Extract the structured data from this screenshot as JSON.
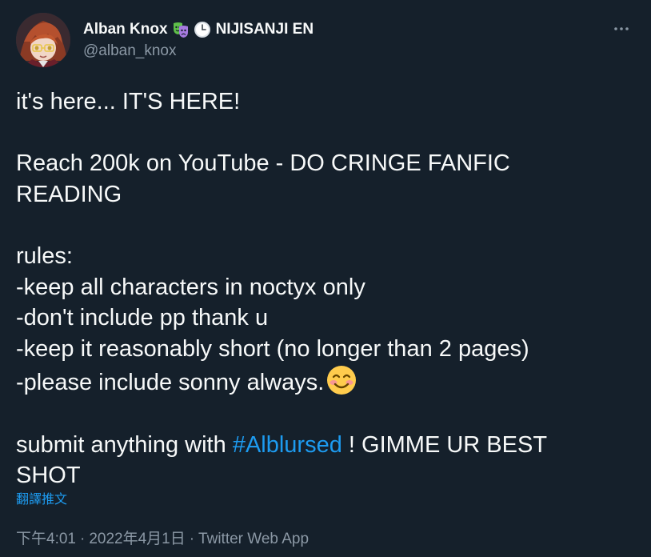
{
  "author": {
    "display_name": "Alban Knox",
    "badge_icons": [
      "theater-masks-icon",
      "clock-icon"
    ],
    "name_suffix": "NIJISANJI EN",
    "handle": "@alban_knox"
  },
  "tweet": {
    "lines": [
      "it's here... IT'S HERE!",
      "",
      "Reach 200k on YouTube - DO CRINGE FANFIC",
      "READING",
      "",
      "rules:",
      "-keep all characters in noctyx only",
      "-don't include pp thank u",
      "-keep it reasonably short (no longer than 2 pages)",
      "-please include sonny always.",
      ""
    ],
    "closing_prefix": "submit anything with ",
    "hashtag": "#Alblursed",
    "closing_suffix": " ! GIMME UR BEST",
    "closing_line2": "SHOT"
  },
  "translate_label": "翻譯推文",
  "meta": {
    "time": "下午4:01",
    "dot1": "·",
    "date": "2022年4月1日",
    "dot2": "·",
    "source": "Twitter Web App"
  },
  "colors": {
    "background": "#15202b",
    "text": "#f7f9f9",
    "secondary": "#8b98a5",
    "accent": "#1d9bf0"
  }
}
